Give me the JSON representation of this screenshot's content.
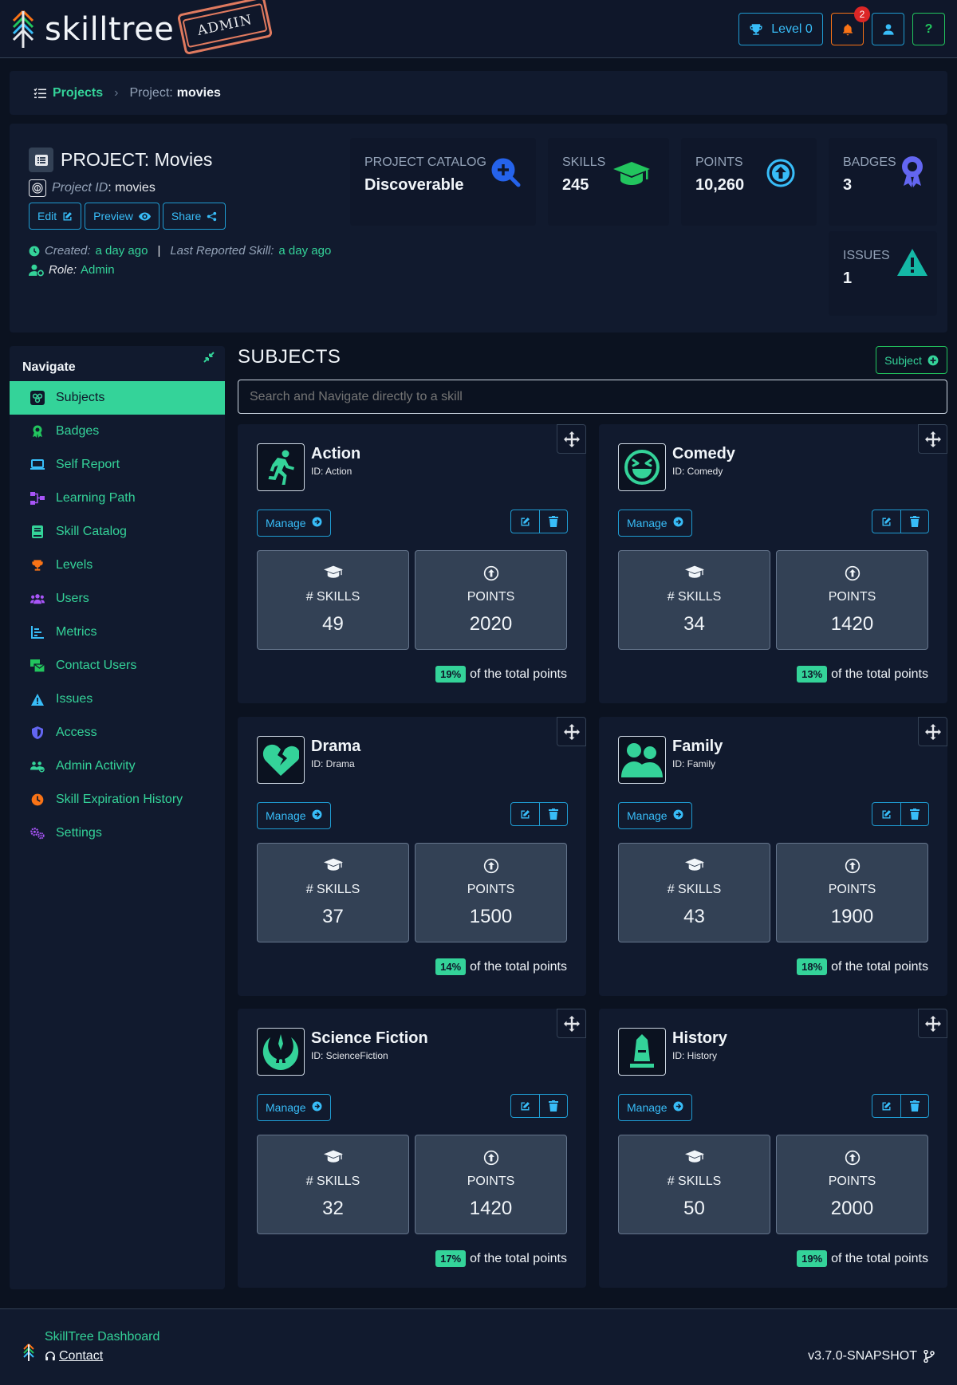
{
  "app": {
    "name": "skilltree",
    "admin_stamp": "ADMIN"
  },
  "topbar": {
    "level_label": "Level 0",
    "notification_count": "2",
    "help_label": "?"
  },
  "breadcrumb": {
    "projects_label": "Projects",
    "project_prefix": "Project:",
    "project_name": "movies"
  },
  "project": {
    "title": "PROJECT: Movies",
    "id_label": "Project ID",
    "id_value": ": movies",
    "edit_label": "Edit",
    "preview_label": "Preview",
    "share_label": "Share",
    "created_label": "Created:",
    "created_value": "a day ago",
    "divider": "|",
    "last_reported_label": "Last Reported Skill:",
    "last_reported_value": "a day ago",
    "role_label": "Role:",
    "role_value": "Admin",
    "stats": {
      "catalog": {
        "label": "PROJECT CATALOG",
        "value": "Discoverable"
      },
      "skills": {
        "label": "SKILLS",
        "value": "245"
      },
      "points": {
        "label": "POINTS",
        "value": "10,260"
      },
      "badges": {
        "label": "BADGES",
        "value": "3"
      },
      "issues": {
        "label": "ISSUES",
        "value": "1"
      }
    }
  },
  "sidebar": {
    "heading": "Navigate",
    "items": [
      {
        "label": "Subjects",
        "icon": "subjects-icon",
        "color": "#0f172a"
      },
      {
        "label": "Badges",
        "icon": "badge-icon",
        "color": "#22c55e"
      },
      {
        "label": "Self Report",
        "icon": "laptop-icon",
        "color": "#38bdf8"
      },
      {
        "label": "Learning Path",
        "icon": "network-icon",
        "color": "#a855f7"
      },
      {
        "label": "Skill Catalog",
        "icon": "book-icon",
        "color": "#34d399"
      },
      {
        "label": "Levels",
        "icon": "trophy-icon",
        "color": "#f97316"
      },
      {
        "label": "Users",
        "icon": "users-icon",
        "color": "#a855f7"
      },
      {
        "label": "Metrics",
        "icon": "chart-icon",
        "color": "#38bdf8"
      },
      {
        "label": "Contact Users",
        "icon": "mail-icon",
        "color": "#22c55e"
      },
      {
        "label": "Issues",
        "icon": "warning-icon",
        "color": "#38bdf8"
      },
      {
        "label": "Access",
        "icon": "shield-icon",
        "color": "#6366f1"
      },
      {
        "label": "Admin Activity",
        "icon": "activity-icon",
        "color": "#34d399"
      },
      {
        "label": "Skill Expiration History",
        "icon": "clock-icon",
        "color": "#f97316"
      },
      {
        "label": "Settings",
        "icon": "gears-icon",
        "color": "#a855f7"
      }
    ]
  },
  "subjects": {
    "title": "SUBJECTS",
    "add_label": "Subject",
    "search_placeholder": "Search and Navigate directly to a skill",
    "manage_label": "Manage",
    "skills_label": "# SKILLS",
    "points_label": "POINTS",
    "total_suffix": "of the total points",
    "cards": [
      {
        "name": "Action",
        "id": "ID: Action",
        "icon": "running-icon",
        "skills": "49",
        "points": "2020",
        "percent": "19%"
      },
      {
        "name": "Comedy",
        "id": "ID: Comedy",
        "icon": "laughing-icon",
        "skills": "34",
        "points": "1420",
        "percent": "13%"
      },
      {
        "name": "Drama",
        "id": "ID: Drama",
        "icon": "broken-heart-icon",
        "skills": "37",
        "points": "1500",
        "percent": "14%"
      },
      {
        "name": "Family",
        "id": "ID: Family",
        "icon": "family-icon",
        "skills": "43",
        "points": "1900",
        "percent": "18%"
      },
      {
        "name": "Science Fiction",
        "id": "ID: ScienceFiction",
        "icon": "jedi-icon",
        "skills": "32",
        "points": "1420",
        "percent": "17%"
      },
      {
        "name": "History",
        "id": "ID: History",
        "icon": "monument-icon",
        "skills": "50",
        "points": "2000",
        "percent": "19%"
      }
    ]
  },
  "footer": {
    "dashboard_label": "SkillTree Dashboard",
    "contact_label": "Contact",
    "version": "v3.7.0-SNAPSHOT"
  }
}
